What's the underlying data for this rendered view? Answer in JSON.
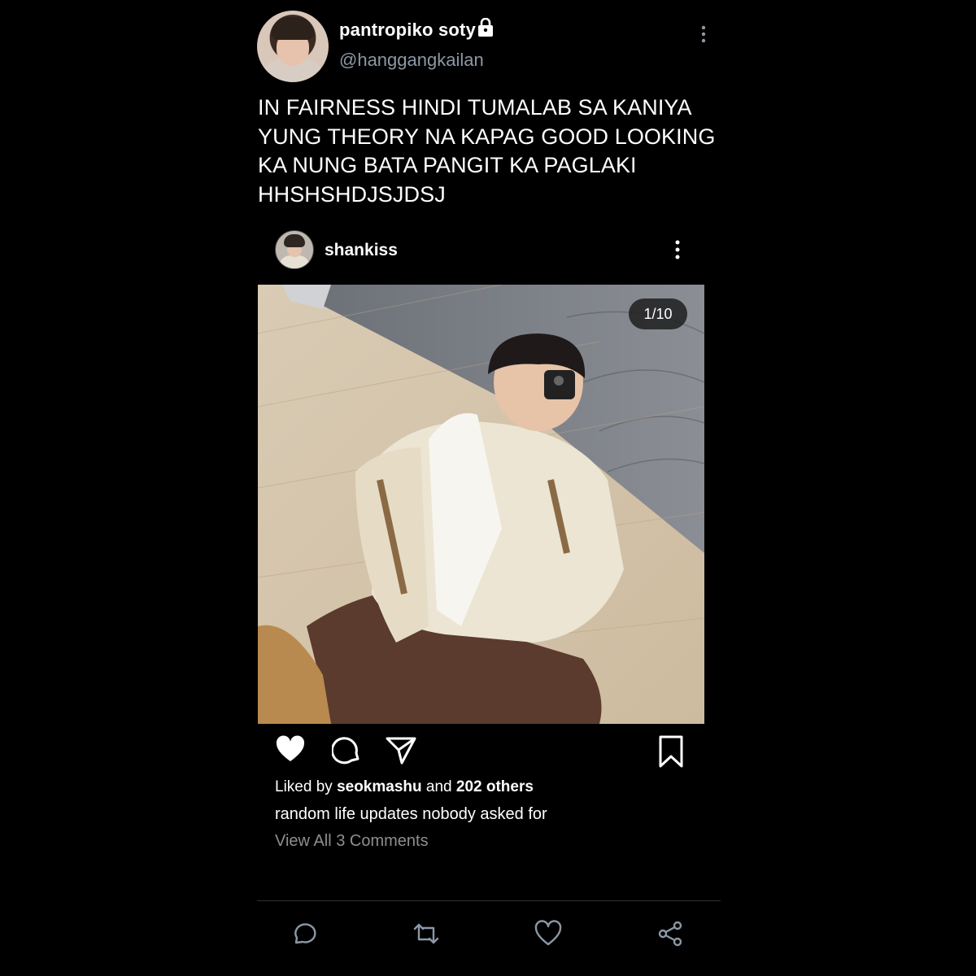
{
  "tweet": {
    "display_name": "pantropiko soty",
    "handle": "@hanggangkailan",
    "text": "IN FAIRNESS HINDI TUMALAB SA KANIYA YUNG THEORY NA KAPAG GOOD LOOKING KA NUNG BATA PANGIT KA PAGLAKI HHSHSHDJSJDSJ",
    "icons": {
      "verified_lock": "lock-icon",
      "more": "more-vertical-icon"
    }
  },
  "instagram": {
    "username": "shankiss",
    "photo_counter": "1/10",
    "liked_prefix": "Liked by",
    "liked_user": "seokmashu",
    "liked_mid": "and",
    "liked_others": "202 others",
    "caption": "random life updates nobody asked for",
    "view_all": "View All 3 Comments",
    "icons": [
      "heart-filled-icon",
      "comment-icon",
      "send-icon",
      "bookmark-icon"
    ]
  },
  "tweet_actions": {
    "icons": [
      "reply-icon",
      "retweet-icon",
      "like-icon",
      "share-icon"
    ]
  },
  "colors": {
    "background": "#000000",
    "text": "#ffffff",
    "secondary": "#8b98a5",
    "muted": "#8e8e8e",
    "divider": "#2f3336"
  }
}
